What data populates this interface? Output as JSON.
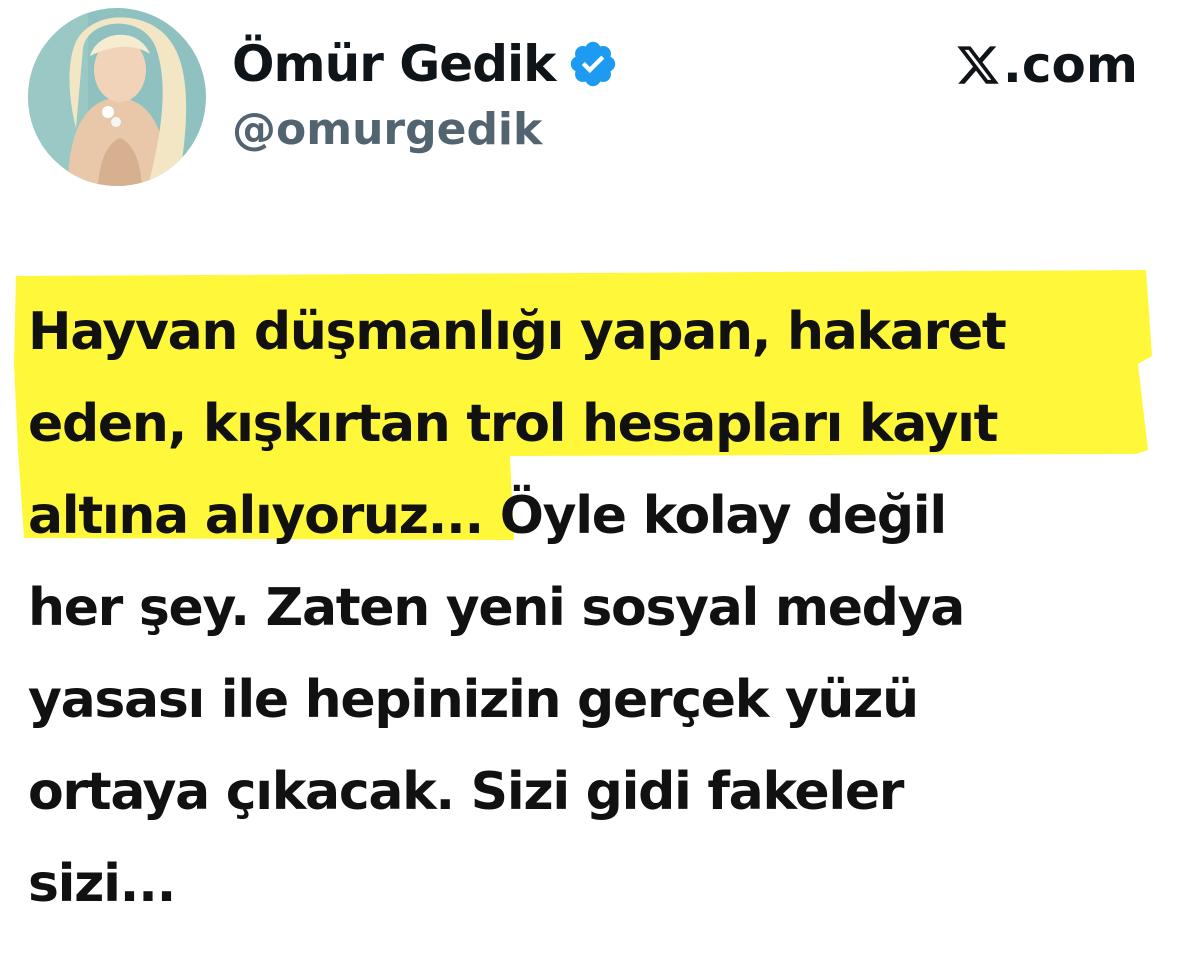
{
  "header": {
    "display_name": "Ömür Gedik",
    "handle": "@omurgedik",
    "brand": ".com",
    "brand_icon": "x-logo-icon",
    "verified_icon": "verified-badge-icon",
    "verified_color": "#1d9bf0"
  },
  "tweet": {
    "highlight_color": "#fff83a",
    "lines": [
      "Hayvan düşmanlığı yapan, hakaret",
      "eden, kışkırtan trol hesapları kayıt",
      "altına alıyoruz...",
      " Öyle kolay değil",
      "her şey. Zaten yeni sosyal medya",
      "yasası ile hepinizin gerçek yüzü",
      "ortaya çıkacak. Sizi gidi fakeler",
      "sizi..."
    ]
  }
}
